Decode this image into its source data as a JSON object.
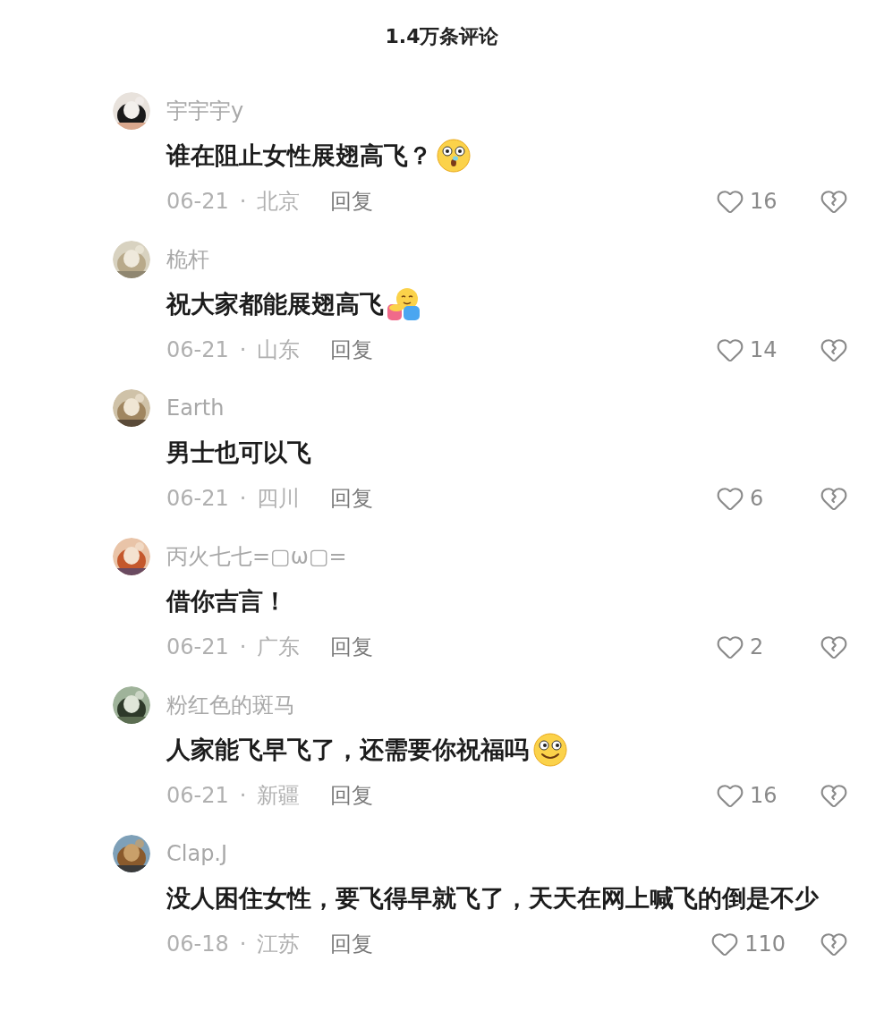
{
  "title": "1.4万条评论",
  "comments": [
    {
      "user": "宇宇宇y",
      "text": "谁在阻止女性展翅高飞？",
      "emoji": {
        "kind": "shocked"
      },
      "date": "06-21",
      "separator": "·",
      "location": "北京",
      "reply": "回复",
      "likes": "16"
    },
    {
      "user": "桅杆",
      "text": "祝大家都能展翅高飞",
      "emoji": {
        "kind": "hug"
      },
      "date": "06-21",
      "separator": "·",
      "location": "山东",
      "reply": "回复",
      "likes": "14"
    },
    {
      "user": "Earth",
      "text": "男士也可以飞",
      "date": "06-21",
      "separator": "·",
      "location": "四川",
      "reply": "回复",
      "likes": "6"
    },
    {
      "user": "丙火七七=▢ω▢=",
      "text": "借你吉言！",
      "date": "06-21",
      "separator": "·",
      "location": "广东",
      "reply": "回复",
      "likes": "2"
    },
    {
      "user": "粉红色的斑马",
      "text": "人家能飞早飞了，还需要你祝福吗",
      "emoji": {
        "kind": "grin"
      },
      "date": "06-21",
      "separator": "·",
      "location": "新疆",
      "reply": "回复",
      "likes": "16"
    },
    {
      "user": "Clap.J",
      "text": "没人困住女性，要飞得早就飞了，天天在网上喊飞的倒是不少",
      "date": "06-18",
      "separator": "·",
      "location": "江苏",
      "reply": "回复",
      "likes": "110"
    }
  ]
}
